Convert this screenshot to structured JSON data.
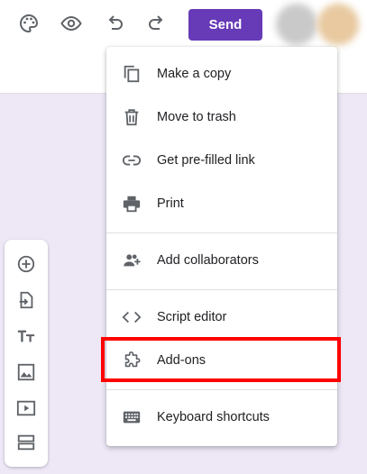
{
  "toolbar": {
    "icons": [
      "palette-icon",
      "eye-icon",
      "undo-icon",
      "redo-icon"
    ],
    "send_label": "Send",
    "accent_color": "#673ab7"
  },
  "menu": {
    "items": [
      {
        "label": "Make a copy",
        "icon": "copy-icon"
      },
      {
        "label": "Move to trash",
        "icon": "trash-icon"
      },
      {
        "label": "Get pre-filled link",
        "icon": "link-icon"
      },
      {
        "label": "Print",
        "icon": "print-icon"
      },
      {
        "label": "Add collaborators",
        "icon": "add-people-icon"
      },
      {
        "label": "Script editor",
        "icon": "code-icon"
      },
      {
        "label": "Add-ons",
        "icon": "puzzle-icon"
      },
      {
        "label": "Keyboard shortcuts",
        "icon": "keyboard-icon"
      }
    ],
    "highlighted": "Add-ons",
    "highlight_color": "#ff0000"
  },
  "side_toolbar": {
    "icons": [
      "add-question-icon",
      "import-questions-icon",
      "add-title-icon",
      "add-image-icon",
      "add-video-icon",
      "add-section-icon"
    ]
  },
  "colors": {
    "background": "#ede7f6"
  }
}
